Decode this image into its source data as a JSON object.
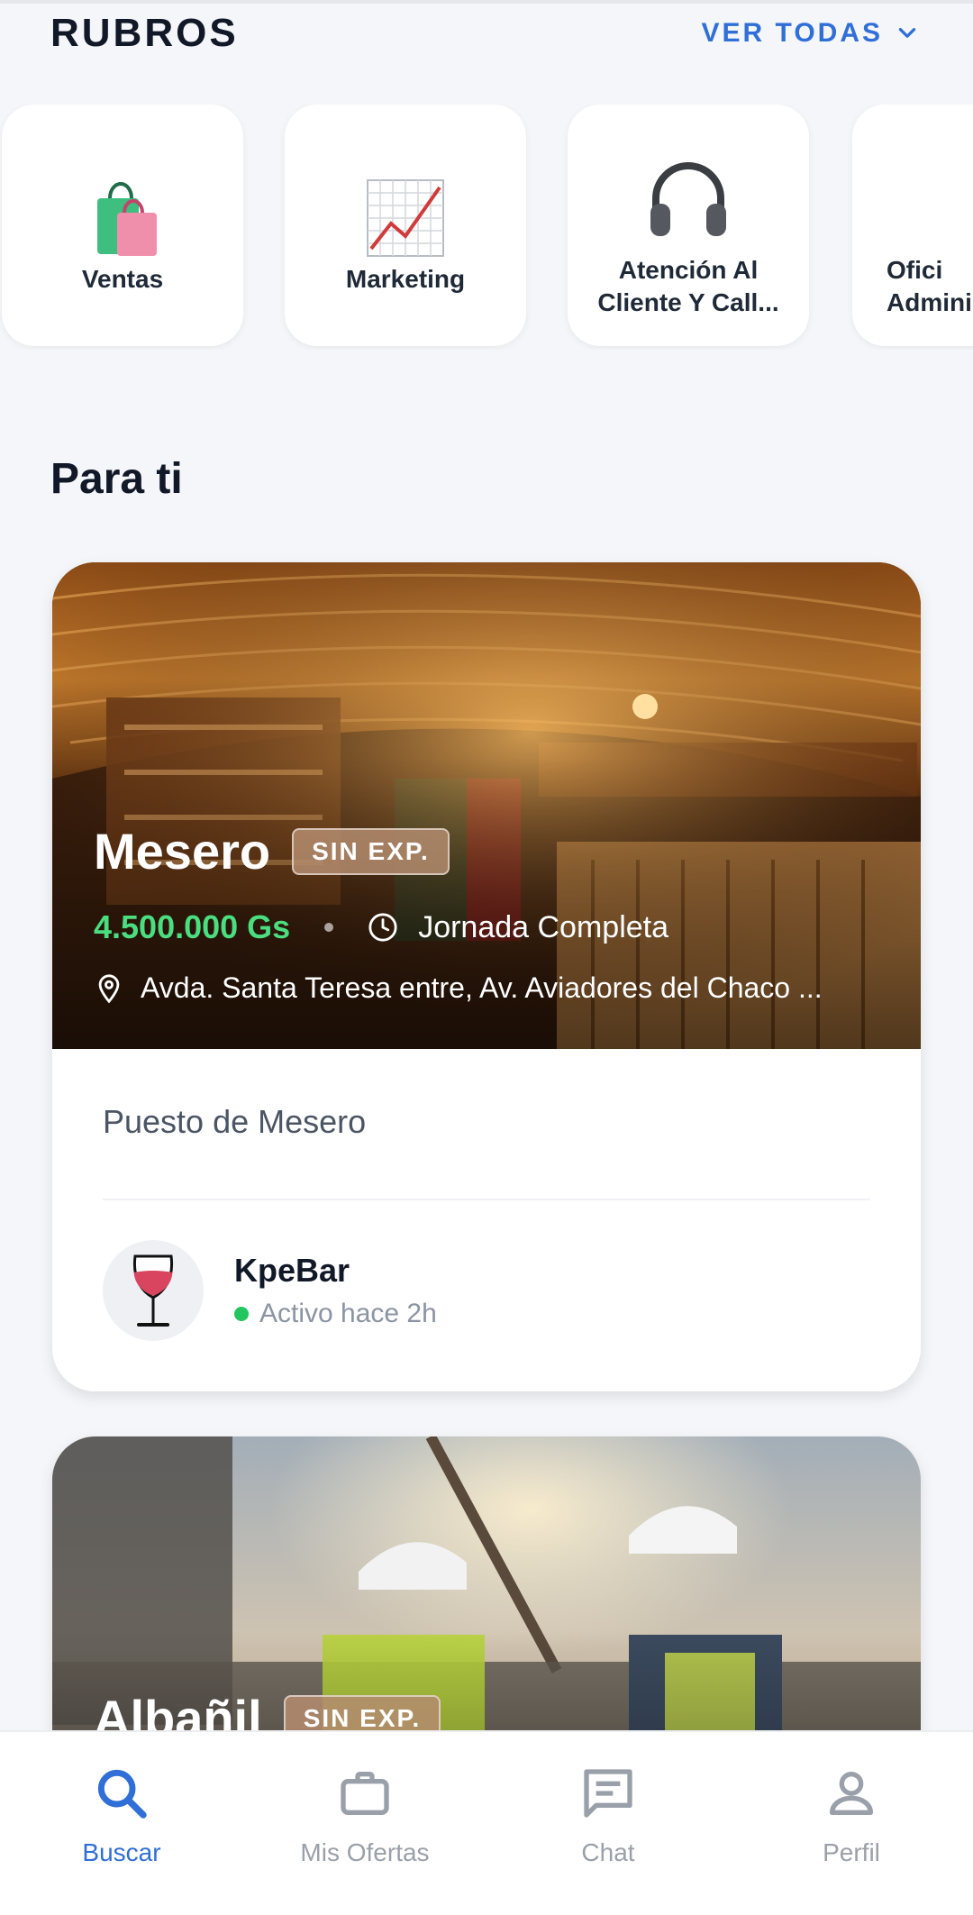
{
  "rubros": {
    "title": "RUBROS",
    "ver_todas": "VER TODAS",
    "categories": [
      {
        "label": "Ventas",
        "icon": "shopping-bags-icon"
      },
      {
        "label": "Marketing",
        "icon": "chart-up-icon"
      },
      {
        "label_lines": [
          "Atención Al",
          "Cliente Y Call..."
        ],
        "icon": "headphones-icon"
      },
      {
        "label_lines": [
          "Ofici",
          "Adminis"
        ],
        "icon": "file-cabinet-icon"
      }
    ]
  },
  "para_ti": {
    "title": "Para ti",
    "jobs": [
      {
        "title": "Mesero",
        "badge": "SIN EXP.",
        "salary": "4.500.000 Gs",
        "schedule": "Jornada Completa",
        "location": "Avda. Santa Teresa entre, Av. Aviadores del Chaco ...",
        "description": "Puesto de Mesero",
        "employer": {
          "name": "KpeBar",
          "status": "Activo hace 2h"
        }
      },
      {
        "title": "Albañil",
        "badge": "SIN EXP."
      }
    ]
  },
  "nav": {
    "items": [
      {
        "label": "Buscar",
        "icon": "search-icon",
        "active": true
      },
      {
        "label": "Mis Ofertas",
        "icon": "briefcase-icon"
      },
      {
        "label": "Chat",
        "icon": "chat-icon"
      },
      {
        "label": "Perfil",
        "icon": "person-icon"
      }
    ]
  },
  "colors": {
    "accent": "#2f6fd7",
    "salary": "#4ade80",
    "status_active": "#22c55e"
  }
}
